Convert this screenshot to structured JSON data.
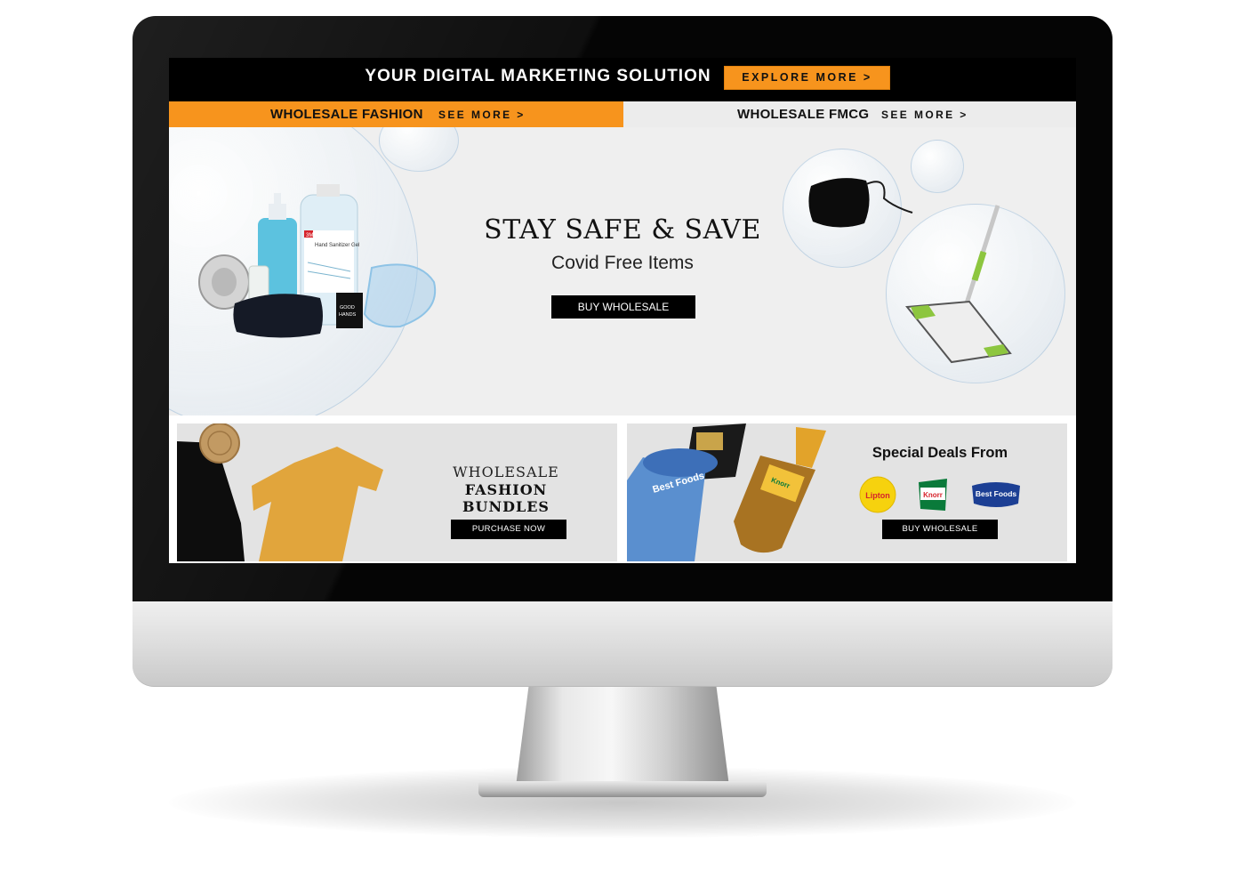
{
  "topbar": {
    "title": "YOUR DIGITAL MARKETING SOLUTION",
    "explore_label": "EXPLORE MORE >"
  },
  "categories": [
    {
      "name": "WHOLESALE FASHION",
      "link": "SEE MORE >",
      "bg": "#f7941d"
    },
    {
      "name": "WHOLESALE FMCG",
      "link": "SEE MORE >",
      "bg": "#ececec"
    }
  ],
  "hero": {
    "title": "STAY SAFE & SAVE",
    "subtitle": "Covid Free Items",
    "button": "BUY WHOLESALE"
  },
  "promo_fashion": {
    "title_line1": "WHOLESALE",
    "title_line2": "FASHION BUNDLES",
    "button": "PURCHASE NOW"
  },
  "promo_fmcg": {
    "title": "Special Deals From",
    "brands": [
      "Lipton",
      "Knorr",
      "Best Foods"
    ],
    "button": "BUY WHOLESALE"
  },
  "product_labels": {
    "sanitizer_brand": "3M",
    "sanitizer_name": "Hand Sanitizer Gel",
    "good_hands_line1": "GOOD",
    "good_hands_line2": "HANDS",
    "best_foods_pack": "Best Foods",
    "knorr_bottle": "Knorr"
  },
  "colors": {
    "accent_orange": "#f7941d",
    "black": "#000000",
    "hero_bg": "#efefef",
    "promo_bg": "#e3e3e3"
  }
}
